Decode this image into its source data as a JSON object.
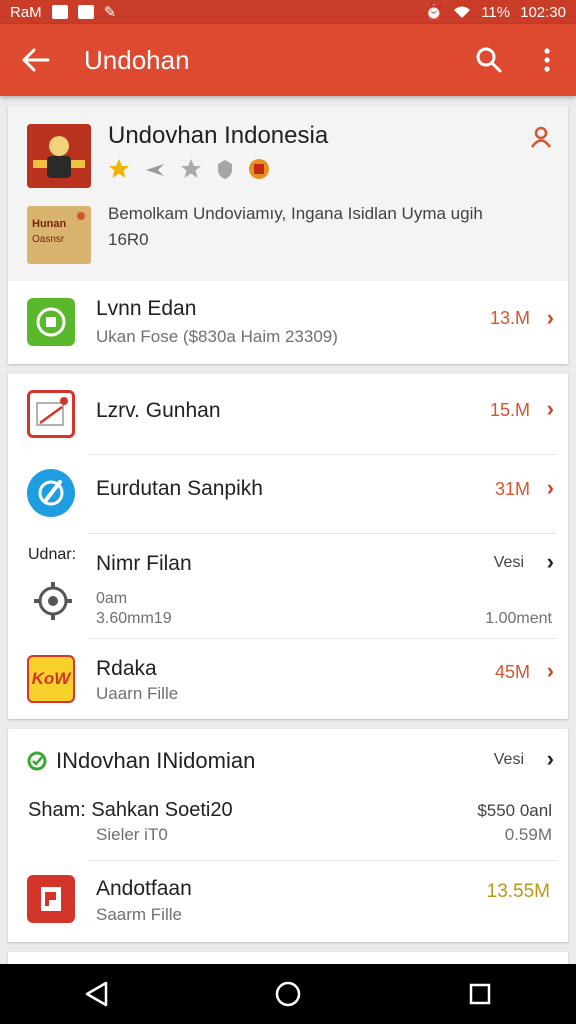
{
  "status_bar": {
    "left_label": "RaM",
    "battery": "11%",
    "time": "102:30"
  },
  "app_bar": {
    "title": "Undohan"
  },
  "header": {
    "title": "Undovhan Indonesia",
    "description_line1": "Bemolkam Undoviamıy, Ingana Isidlan Uyma ugih",
    "description_line2": "16R0",
    "banner_text1": "Hunan",
    "banner_text2": "Oasnsr"
  },
  "card1": {
    "row": {
      "title": "Lvnn Edan",
      "subtitle": "Ukan Fose ($830a Haim 23309)",
      "size": "13.M"
    }
  },
  "card2": {
    "rows": [
      {
        "title": "Lzrv. Gunhan",
        "size": "15.M"
      },
      {
        "title": "Eurdutan Sanpikh",
        "size": "31M"
      },
      {
        "pre_label": "Udnar:",
        "title": "Nimr Filan",
        "right_label": "Vesi",
        "subtitle1": "0am",
        "subtitle2": "3.60mm19",
        "right_value": "1.00ment"
      },
      {
        "title": "Rdaka",
        "subtitle": "Uaarn Fille",
        "size": "45M",
        "icon_text": "KoW"
      }
    ]
  },
  "card3": {
    "header_title": "INdovhan INidomian",
    "header_right": "Vesi",
    "row1": {
      "title": "Sham: Sahkan Soeti20",
      "subtitle": "Sieler iT0",
      "right1": "$550 0anl",
      "right2": "0.59M"
    },
    "row2": {
      "title": "Andotfaan",
      "subtitle": "Saarm Fille",
      "size": "13.55M"
    }
  },
  "colors": {
    "appbar": "#de4a30",
    "statusbar": "#c83c28",
    "accent_orange": "#d4552e",
    "size_yellow": "#b59a18"
  }
}
